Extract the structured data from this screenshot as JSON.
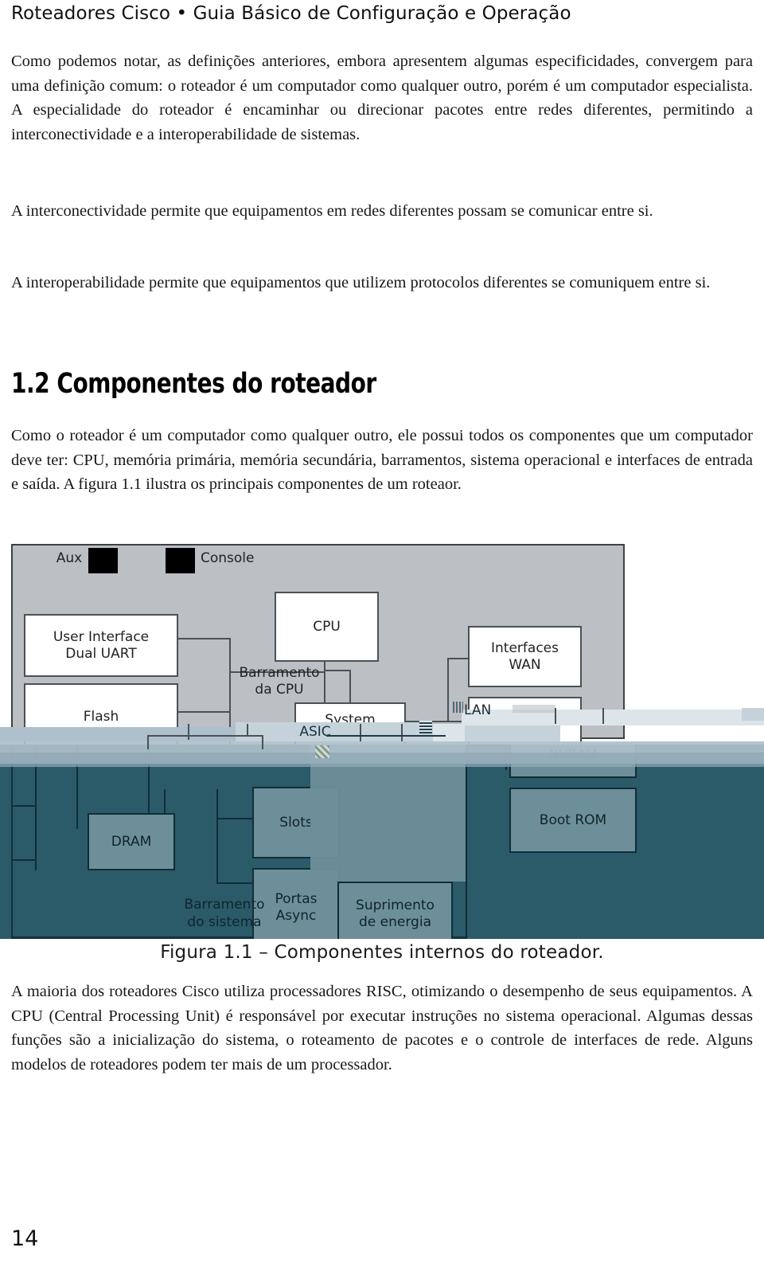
{
  "header": {
    "running_head": "Roteadores Cisco • Guia Básico de Configuração e Operação"
  },
  "body": {
    "paragraphs": [
      "Como podemos notar, as definições anteriores, embora apresentem algumas especificidades, convergem para uma definição comum: o roteador é um computador como qualquer outro, porém é um computador especialista. A especialidade do roteador é encaminhar ou direcionar pacotes entre redes diferentes, permitindo a interconectividade e a interoperabilidade de sistemas.",
      "A interconectividade permite que equipamentos em redes diferentes possam se comunicar entre si.",
      "A interoperabilidade permite que equipamentos que utilizem protocolos diferentes se comuniquem entre si."
    ],
    "heading": "1.2 Componentes do roteador",
    "after_heading": "Como o roteador é um computador como qualquer outro, ele possui todos os componentes que um computador deve ter: CPU, memória primária, memória secundária, barramentos, sistema operacional e interfaces de entrada e saída. A figura 1.1 ilustra os principais componentes de um roteaor.",
    "after_figure": "A maioria dos roteadores Cisco utiliza processadores RISC, otimizando o desempenho de seus equipamentos. A CPU (Central Processing Unit) é responsável por executar instruções no sistema operacional. Algumas dessas funções são a inicialização do sistema, o roteamento de pacotes e o controle de interfaces de rede. Alguns modelos de roteadores podem ter mais de um processador."
  },
  "figure": {
    "caption": "Figura 1.1 – Componentes internos do roteador.",
    "labels": {
      "aux": "Aux",
      "console": "Console",
      "user_interface": "User Interface\nDual UART",
      "flash": "Flash",
      "cpu": "CPU",
      "cpu_bus": "Barramento\nda CPU",
      "system_control": "System\nControl",
      "asic": "ASIC",
      "interfaces_wan": "Interfaces\nWAN",
      "interfaces_lan": "Interfaces\nLAN",
      "lan_glitch": "LAN",
      "dram": "DRAM",
      "slots": "Slots",
      "portas_async": "Portas\nAsync",
      "system_bus": "Barramento\ndo sistema",
      "nvram": "NVRAM",
      "boot_rom": "Boot ROM",
      "power_supply": "Suprimento\nde energia"
    },
    "colors": {
      "grey_panel": "#bcc0c4",
      "teal_zone": "#2b5a68",
      "teal_box": "#6d8f9a",
      "band_light": "#dde5ea",
      "band_mid": "#aec0cb",
      "outline": "#4b5157",
      "outline_dark": "#0f2e38"
    }
  },
  "folio": {
    "page_number": "14"
  }
}
